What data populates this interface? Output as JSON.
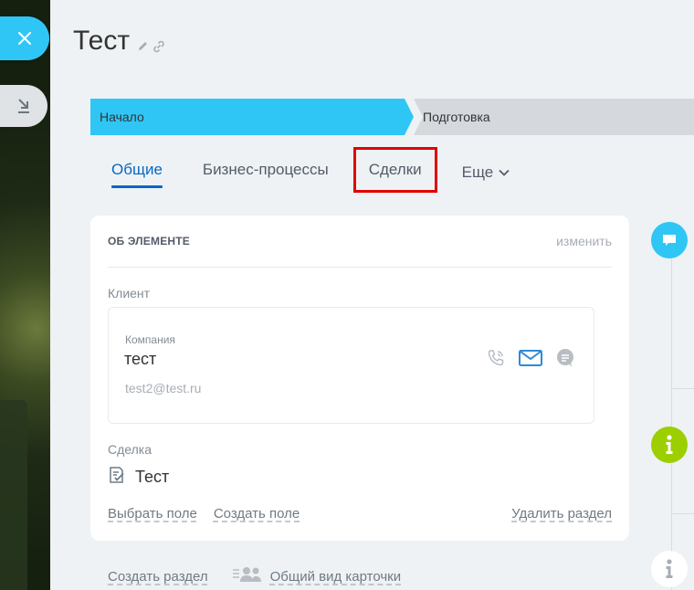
{
  "header": {
    "title": "Тест"
  },
  "stages": [
    {
      "label": "Начало",
      "color": "#2fc6f6"
    },
    {
      "label": "Подготовка",
      "color": "#d5d9de"
    }
  ],
  "tabs": [
    {
      "label": "Общие"
    },
    {
      "label": "Бизнес-процессы"
    },
    {
      "label": "Сделки"
    },
    {
      "label": "Еще"
    }
  ],
  "card": {
    "title": "ОБ ЭЛЕМЕНТЕ",
    "edit_label": "изменить",
    "client_label": "Клиент",
    "client": {
      "type": "Компания",
      "name": "тест",
      "email": "test2@test.ru"
    },
    "deal_label": "Сделка",
    "deal_name": "Тест",
    "select_field": "Выбрать поле",
    "create_field": "Создать поле",
    "delete_section": "Удалить раздел"
  },
  "bottom": {
    "create_section": "Создать раздел",
    "common_view": "Общий вид карточки"
  },
  "colors": {
    "accent": "#2fc6f6",
    "tab_active": "#0b66c3",
    "highlight": "#e00000",
    "info_green": "#9dcf00"
  }
}
